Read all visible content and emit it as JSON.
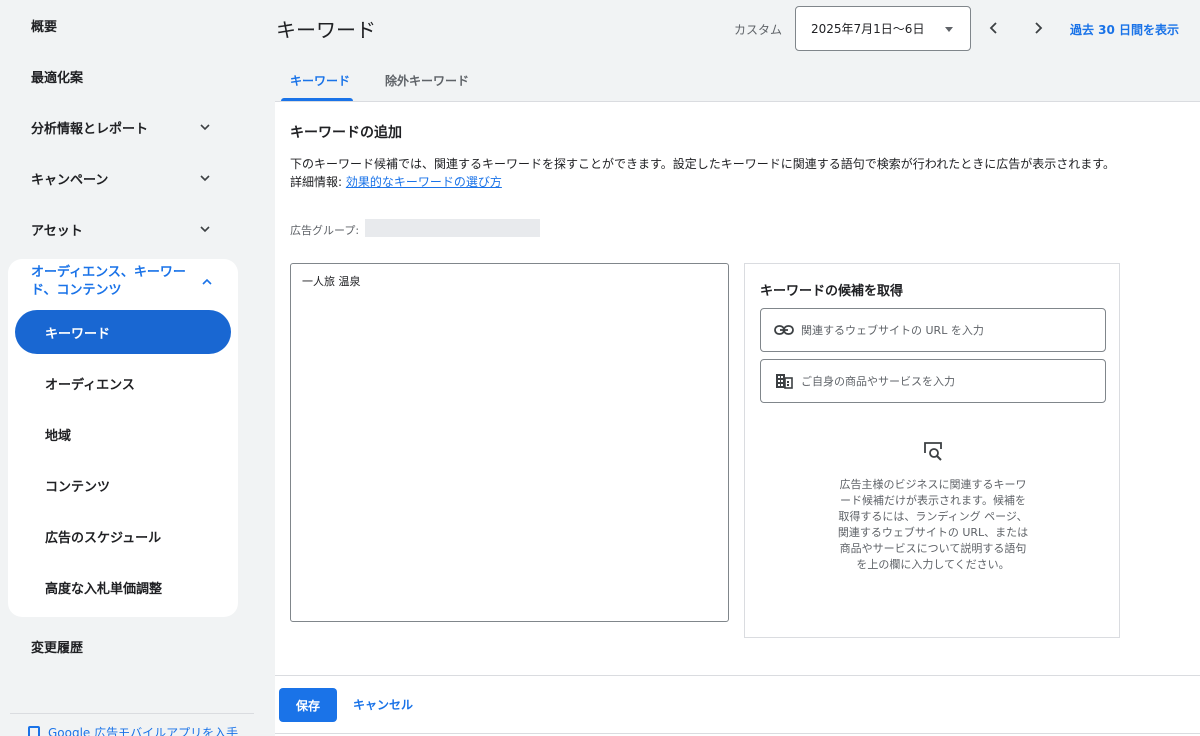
{
  "sidebar": {
    "overview": "概要",
    "recommendations": "最適化案",
    "insights": "分析情報とレポート",
    "campaigns": "キャンペーン",
    "assets": "アセット",
    "group": {
      "label": "オーディエンス、キーワード、コンテンツ",
      "items": [
        {
          "label": "キーワード",
          "active": true
        },
        {
          "label": "オーディエンス"
        },
        {
          "label": "地域"
        },
        {
          "label": "コンテンツ"
        },
        {
          "label": "広告のスケジュール"
        },
        {
          "label": "高度な入札単価調整"
        }
      ]
    },
    "change_history": "変更履歴",
    "app_promo": "Google 広告モバイルアプリを入手"
  },
  "header": {
    "title": "キーワード",
    "custom_label": "カスタム",
    "date_range": "2025年7月1日〜6日",
    "last30_label": "過去 30 日間を表示"
  },
  "tabs": [
    {
      "label": "キーワード",
      "active": true
    },
    {
      "label": "除外キーワード"
    }
  ],
  "main": {
    "section_title": "キーワードの追加",
    "description": "下のキーワード候補では、関連するキーワードを探すことができます。設定したキーワードに関連する語句で検索が行われたときに広告が表示されます。",
    "learn_more_prefix": "詳細情報: ",
    "learn_more_link": "効果的なキーワードの選び方",
    "ad_group_label": "広告グループ:",
    "keywords_text": "一人旅 温泉",
    "suggest": {
      "title": "キーワードの候補を取得",
      "url_placeholder": "関連するウェブサイトの URL を入力",
      "product_placeholder": "ご自身の商品やサービスを入力",
      "help_text": "広告主様のビジネスに関連するキーワード候補だけが表示されます。候補を取得するには、ランディング ページ、関連するウェブサイトの URL、または商品やサービスについて説明する語句を上の欄に入力してください。"
    }
  },
  "footer": {
    "save_label": "保存",
    "cancel_label": "キャンセル"
  },
  "colors": {
    "accent": "#1a73e8",
    "active_nav": "#1967d2"
  }
}
